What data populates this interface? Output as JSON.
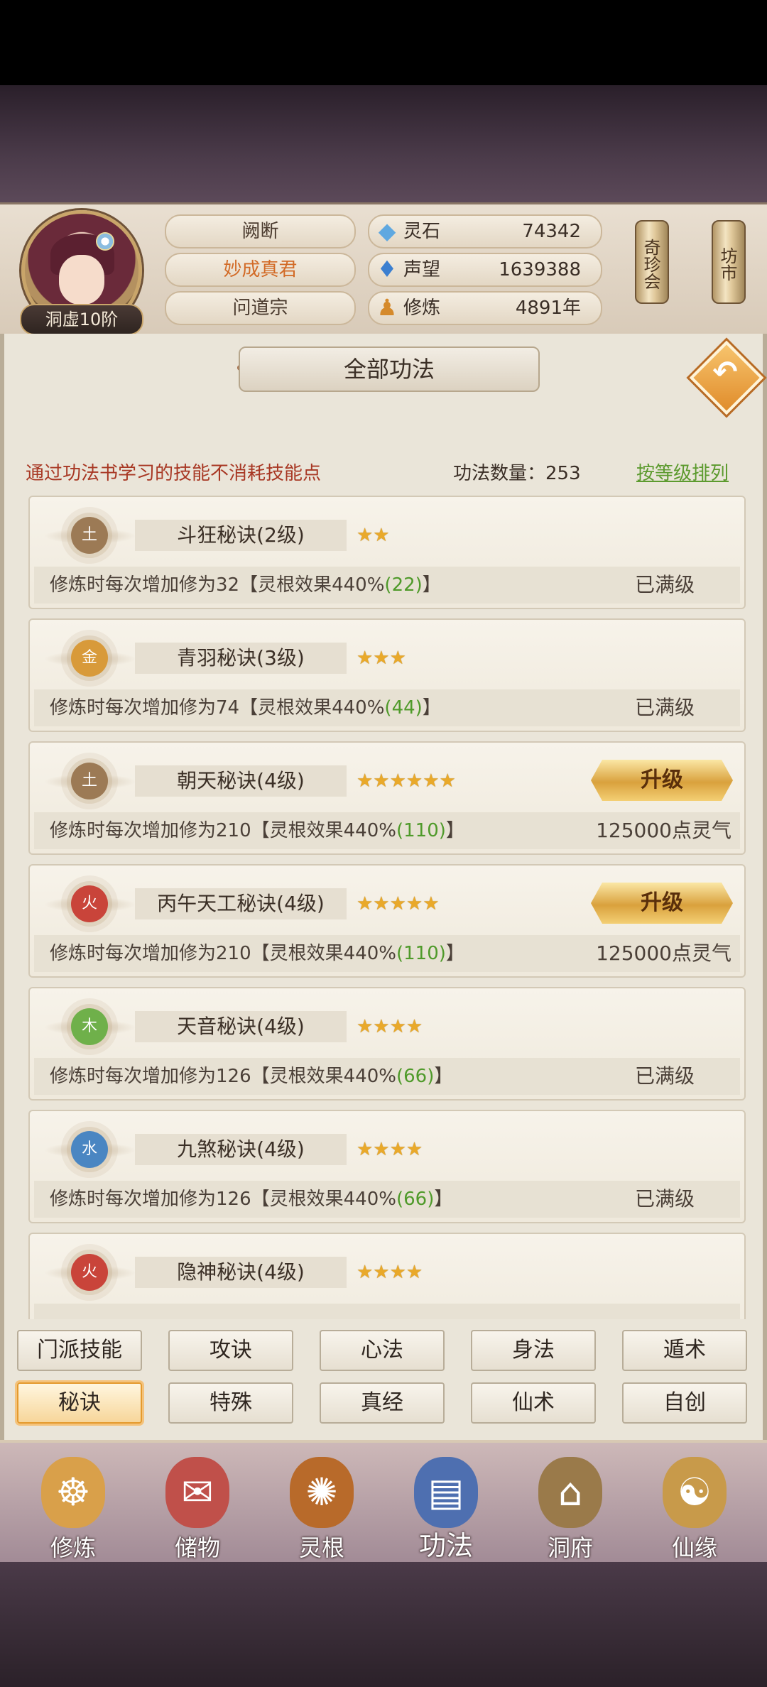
{
  "header": {
    "rank": "洞虚10阶",
    "names": [
      "阙断",
      "妙成真君",
      "问道宗"
    ],
    "stats": [
      {
        "icon": "spirit-stone-icon",
        "label": "灵石",
        "value": "74342"
      },
      {
        "icon": "reputation-icon",
        "label": "声望",
        "value": "1639388"
      },
      {
        "icon": "cultivation-icon",
        "label": "修炼",
        "value": "4891年"
      }
    ],
    "buttons": [
      "奇珍会",
      "坊市"
    ]
  },
  "panel": {
    "title": "全部功法",
    "note": "通过功法书学习的技能不消耗技能点",
    "count_label": "功法数量：253",
    "sort_label": "按等级排列"
  },
  "skills": [
    {
      "element": "土",
      "name": "斗狂秘诀(2级)",
      "stars": "★★",
      "desc": "修炼时每次增加修为32【灵根效果440%",
      "bonus": "(22)",
      "desc_end": "】",
      "status": "已满级",
      "upgrade": ""
    },
    {
      "element": "金",
      "name": "青羽秘诀(3级)",
      "stars": "★★★",
      "desc": "修炼时每次增加修为74【灵根效果440%",
      "bonus": "(44)",
      "desc_end": "】",
      "status": "已满级",
      "upgrade": ""
    },
    {
      "element": "土",
      "name": "朝天秘诀(4级)",
      "stars": "★★★★★★",
      "desc": "修炼时每次增加修为210【灵根效果440%",
      "bonus": "(110)",
      "desc_end": "】",
      "status": "125000点灵气",
      "upgrade": "升级"
    },
    {
      "element": "火",
      "name": "丙午天工秘诀(4级)",
      "stars": "★★★★★",
      "desc": "修炼时每次增加修为210【灵根效果440%",
      "bonus": "(110)",
      "desc_end": "】",
      "status": "125000点灵气",
      "upgrade": "升级"
    },
    {
      "element": "木",
      "name": "天音秘诀(4级)",
      "stars": "★★★★",
      "desc": "修炼时每次增加修为126【灵根效果440%",
      "bonus": "(66)",
      "desc_end": "】",
      "status": "已满级",
      "upgrade": ""
    },
    {
      "element": "水",
      "name": "九煞秘诀(4级)",
      "stars": "★★★★",
      "desc": "修炼时每次增加修为126【灵根效果440%",
      "bonus": "(66)",
      "desc_end": "】",
      "status": "已满级",
      "upgrade": ""
    },
    {
      "element": "火",
      "name": "隐神秘诀(4级)",
      "stars": "★★★★",
      "desc": "",
      "bonus": "",
      "desc_end": "",
      "status": "",
      "upgrade": ""
    }
  ],
  "colors": {
    "土": "#9c7a55",
    "金": "#d89a3a",
    "火": "#c9443a",
    "木": "#6fb04a",
    "水": "#4a86c2"
  },
  "tabs": [
    "门派技能",
    "攻诀",
    "心法",
    "身法",
    "遁术",
    "秘诀",
    "特殊",
    "真经",
    "仙术",
    "自创"
  ],
  "active_tab": "秘诀",
  "nav": [
    {
      "label": "修炼",
      "icon": "cultivate-icon"
    },
    {
      "label": "储物",
      "icon": "storage-bag-icon"
    },
    {
      "label": "灵根",
      "icon": "spirit-root-icon"
    },
    {
      "label": "功法",
      "icon": "skill-book-icon"
    },
    {
      "label": "洞府",
      "icon": "cave-dwelling-icon"
    },
    {
      "label": "仙缘",
      "icon": "immortal-fate-icon"
    }
  ],
  "active_nav": "功法"
}
